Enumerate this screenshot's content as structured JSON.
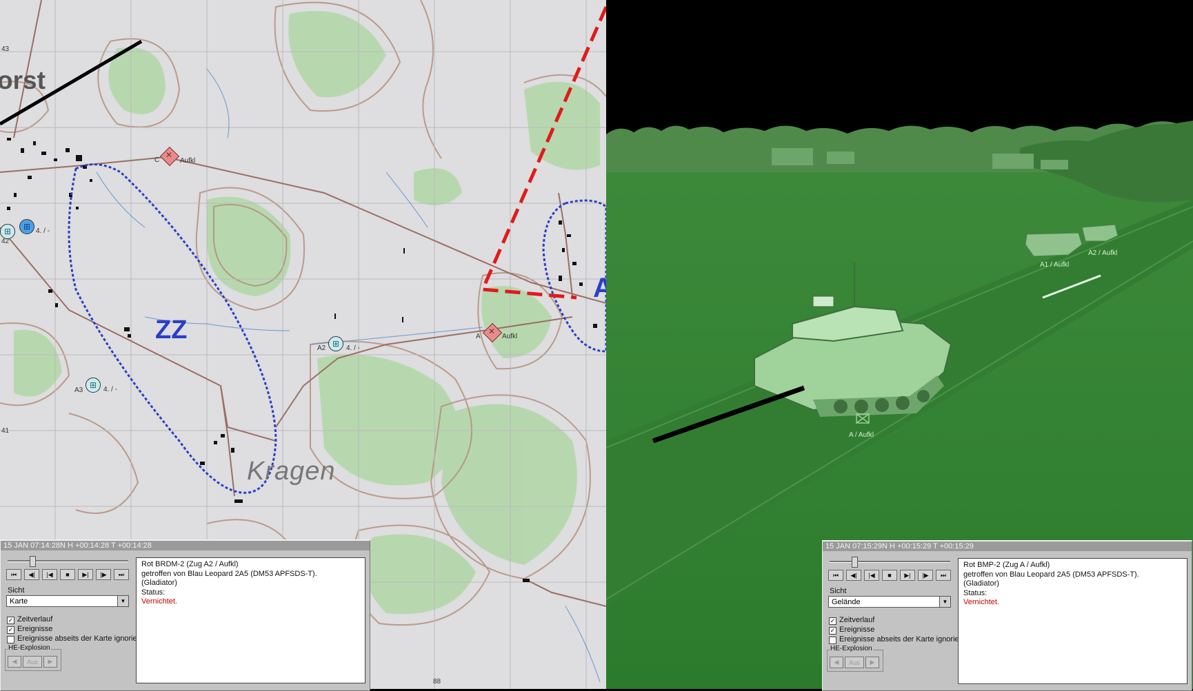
{
  "map": {
    "town_label_left": "orst",
    "town_label_bottom": "Kragen",
    "zone_label": "ZZ",
    "zone_label_right": "A",
    "grid_numbers": [
      "43",
      "41",
      "88"
    ],
    "units": [
      {
        "id": "A2",
        "label": "A2",
        "sub": "4. / -"
      },
      {
        "id": "A3",
        "label": "A3",
        "sub": "4. / -"
      },
      {
        "id": "A1",
        "label": "42",
        "sub": "4. / -"
      }
    ],
    "enemies": [
      {
        "prefix": "C",
        "label": "Aufkl"
      },
      {
        "prefix": "A",
        "label": "Aufkl"
      }
    ],
    "colors": {
      "friendly": "#2a3fc7",
      "enemy": "#e11a1a",
      "contour": "#b48f7e",
      "forest": "#a9d59e"
    }
  },
  "left_panel": {
    "time": "15 JAN  07:14:28N   H +00:14:28   T +00:14:28",
    "sicht_label": "Sicht",
    "sicht_value": "Karte",
    "checkboxes": [
      {
        "label": "Zeitverlauf",
        "checked": true
      },
      {
        "label": "Ereignisse",
        "checked": true
      },
      {
        "label": "Ereignisse abseits der Karte ignorieren",
        "checked": false
      }
    ],
    "he_label": "HE-Explosion",
    "he_mid": "Aus",
    "message": {
      "line1": "Rot BRDM-2 (Zug A2 / Aufkl)",
      "line2": "getroffen von Blau Leopard 2A5 (DM53 APFSDS-T).",
      "line3": "(Gladiator)",
      "line4": "Status:",
      "line5": "Vernichtet."
    }
  },
  "view": {
    "vehicle_labels": [
      "A1 / Aufkl",
      "A2 / Aufkl",
      "A / Aufkl"
    ]
  },
  "right_panel": {
    "time": "15 JAN  07:15:29N   H +00:15:29   T +00:15:29",
    "sicht_label": "Sicht",
    "sicht_value": "Gelände",
    "checkboxes": [
      {
        "label": "Zeitverlauf",
        "checked": true
      },
      {
        "label": "Ereignisse",
        "checked": true
      },
      {
        "label": "Ereignisse abseits der Karte ignorieren",
        "checked": false
      }
    ],
    "he_label": "HE-Explosion",
    "he_mid": "Aus",
    "message": {
      "line1": "Rot BMP-2 (Zug A / Aufkl)",
      "line2": "getroffen von Blau Leopard 2A5 (DM53 APFSDS-T).",
      "line3": "(Gladiator)",
      "line4": "Status:",
      "line5": "Vernichtet."
    }
  },
  "transport_icons": [
    "rewind-start",
    "step-back",
    "back",
    "stop",
    "forward",
    "step-forward",
    "forward-end"
  ]
}
